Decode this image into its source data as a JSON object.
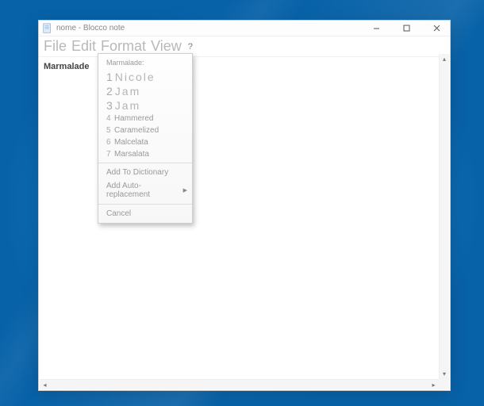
{
  "window": {
    "title": "nome - Blocco note"
  },
  "menubar": {
    "file": "File",
    "edit": "Edit",
    "format": "Format",
    "view": "View",
    "help": "?"
  },
  "document": {
    "text": "Marmalade"
  },
  "context_menu": {
    "header": "Marmalade:",
    "suggestions": [
      {
        "num": "1",
        "label": "Nicole"
      },
      {
        "num": "2",
        "label": "Jam"
      },
      {
        "num": "3",
        "label": "Jam"
      },
      {
        "num": "4",
        "label": "Hammered"
      },
      {
        "num": "5",
        "label": "Caramelized"
      },
      {
        "num": "6",
        "label": "Malcelata"
      },
      {
        "num": "7",
        "label": "Marsalata"
      }
    ],
    "add_dict": "Add To Dictionary",
    "add_auto": "Add Auto-replacement",
    "cancel": "Cancel"
  }
}
